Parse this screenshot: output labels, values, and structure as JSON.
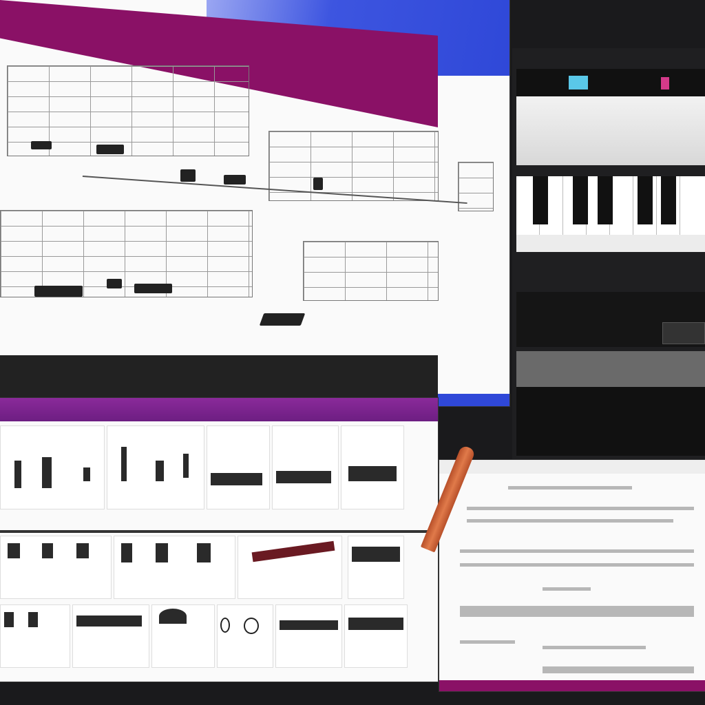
{
  "colors": {
    "magenta": "#8a1166",
    "purple": "#7a2a8e",
    "blue": "#2f48d8",
    "dark": "#1a1a1c",
    "paper": "#fafafa"
  },
  "main_window": {
    "title_left": "",
    "title_right": "",
    "footer_caption": ""
  },
  "bottom_left_window": {
    "title_left": "",
    "title_right": ""
  },
  "right_panel": {
    "label_a": "",
    "label_b": "",
    "label_c": "",
    "label_d": ""
  },
  "bottom_right_window": {
    "header": "",
    "mid_value": ""
  },
  "icons": [
    "piano-keyboard-icon",
    "pencil-icon",
    "circle-icon"
  ]
}
